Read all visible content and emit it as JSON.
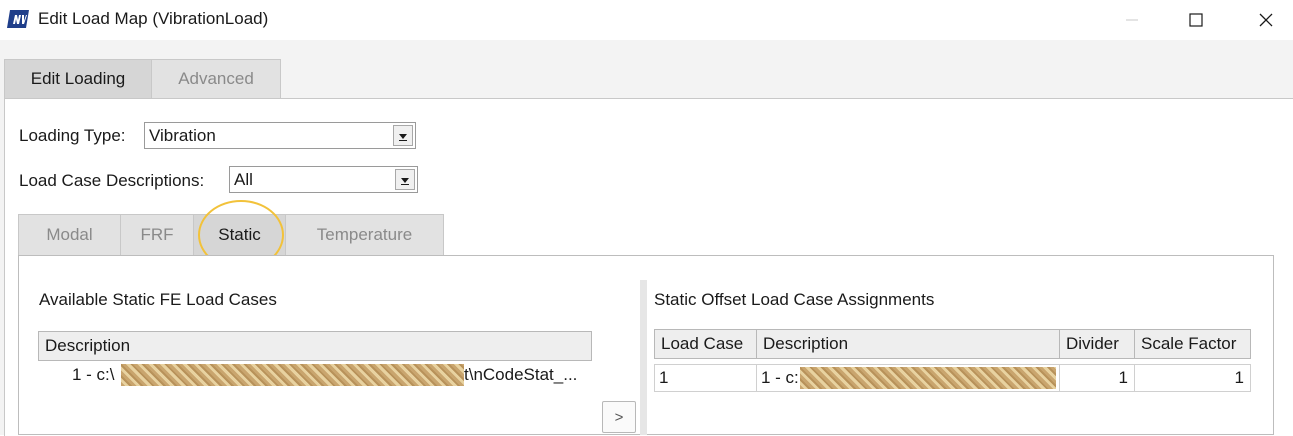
{
  "window": {
    "title": "Edit Load Map (VibrationLoad)",
    "icon": "ncode-logo-icon",
    "controls": {
      "minimize": "—",
      "maximize": "☐",
      "close": "✕"
    }
  },
  "main_tabs": [
    {
      "label": "Edit Loading",
      "active": true
    },
    {
      "label": "Advanced",
      "active": false
    }
  ],
  "loading_type": {
    "label": "Loading Type:",
    "value": "Vibration"
  },
  "load_case_descriptions": {
    "label": "Load Case Descriptions:",
    "value": "All"
  },
  "sub_tabs": [
    {
      "label": "Modal",
      "active": false
    },
    {
      "label": "FRF",
      "active": false
    },
    {
      "label": "Static",
      "active": true
    },
    {
      "label": "Temperature",
      "active": false
    }
  ],
  "available": {
    "title": "Available Static FE Load Cases",
    "column": "Description",
    "rows": [
      {
        "prefix": "1 - c:\\",
        "suffix": "t\\nCodeStat_..."
      }
    ]
  },
  "move_button": ">",
  "assignments": {
    "title": "Static Offset Load Case Assignments",
    "columns": [
      "Load Case",
      "Description",
      "Divider",
      "Scale Factor"
    ],
    "rows": [
      {
        "load_case": "1",
        "description_prefix": "1 - c:",
        "divider": "1",
        "scale_factor": "1"
      }
    ]
  },
  "colors": {
    "highlight": "#f2c23a",
    "logo": "#1f3e8a"
  }
}
